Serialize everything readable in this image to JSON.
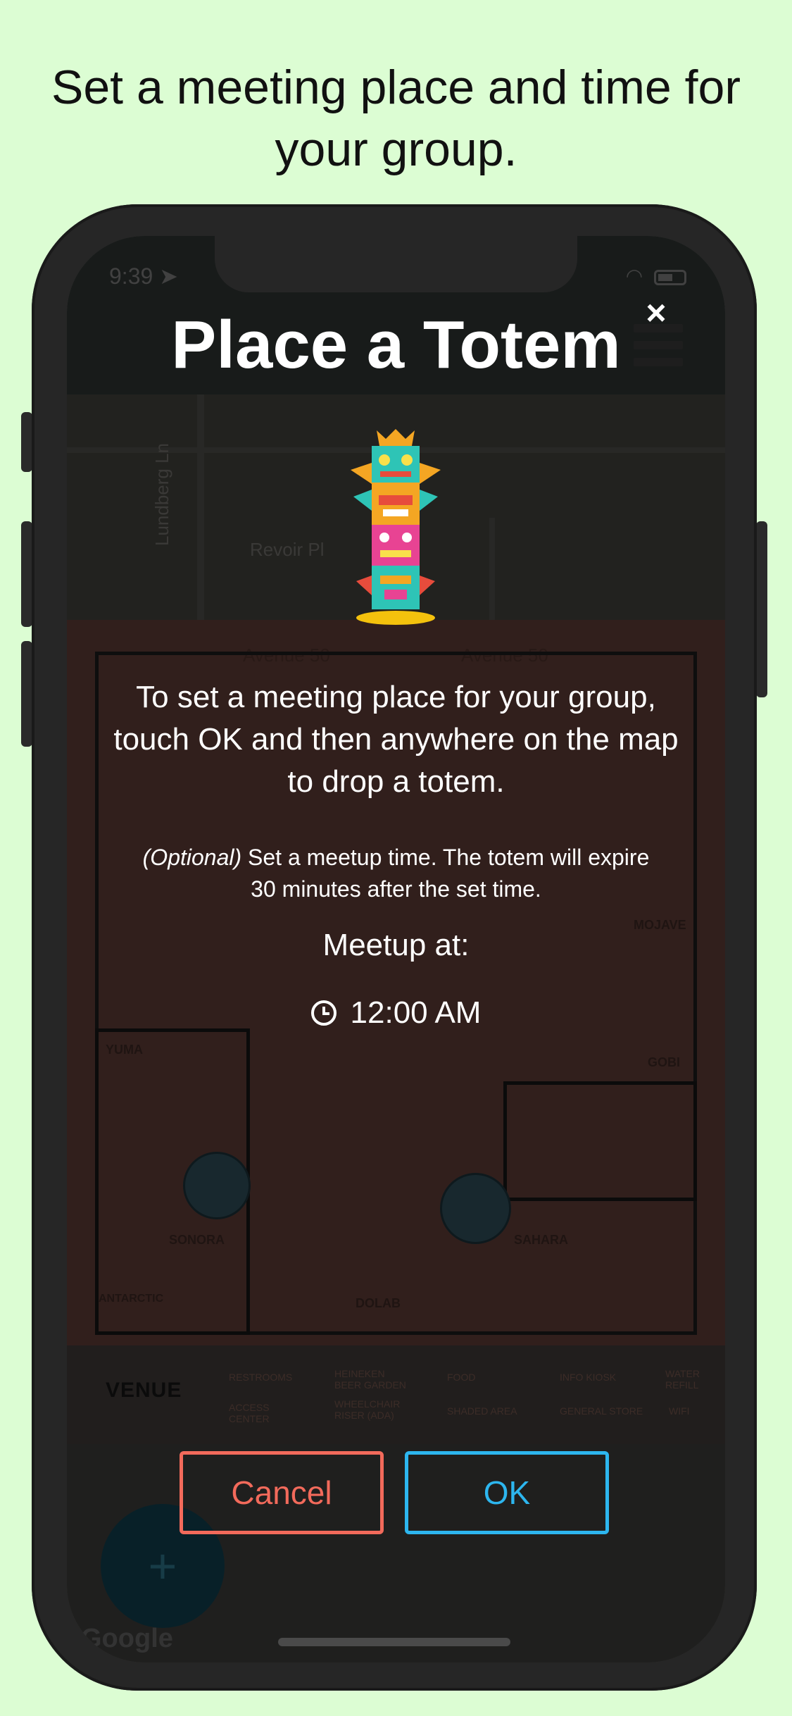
{
  "caption": "Set a meeting place and time for your group.",
  "status": {
    "time": "9:39"
  },
  "modal": {
    "title": "Place a Totem",
    "close_glyph": "×",
    "instructions": "To set a meeting place for your group, touch OK and then anywhere on the map to drop a totem.",
    "optional_label": "(Optional)",
    "optional_text": "Set a meetup time. The totem will expire 30 minutes after the set time.",
    "meetup_label": "Meetup at:",
    "meetup_time": "12:00 AM",
    "cancel_label": "Cancel",
    "ok_label": "OK"
  },
  "map": {
    "streets": [
      "Lundberg Ln",
      "Revoir Pl",
      "Avenue 50",
      "Avenue 50"
    ],
    "stages": [
      "YUMA",
      "SONORA",
      "ANTARCTIC",
      "MOJAVE",
      "GOBI",
      "SAHARA",
      "DOLAB"
    ],
    "legend_title": "VENUE",
    "legend_items": [
      "RESTROOMS",
      "HEINEKEN BEER GARDEN",
      "FOOD",
      "INFO KIOSK",
      "WATER REFILL",
      "ACCESS CENTER",
      "WHEELCHAIR RISER (ADA)",
      "SHADED AREA",
      "GENERAL STORE",
      "WIFI"
    ],
    "fab_glyph": "+",
    "attribution": "Google"
  },
  "colors": {
    "background": "#dcfdd3",
    "cancel": "#f26a5b",
    "ok": "#2db6ef"
  },
  "icons": [
    "close-icon",
    "clock-icon",
    "menu-icon",
    "totem-icon",
    "plus-icon",
    "wifi-icon",
    "battery-icon",
    "location-arrow-icon"
  ]
}
